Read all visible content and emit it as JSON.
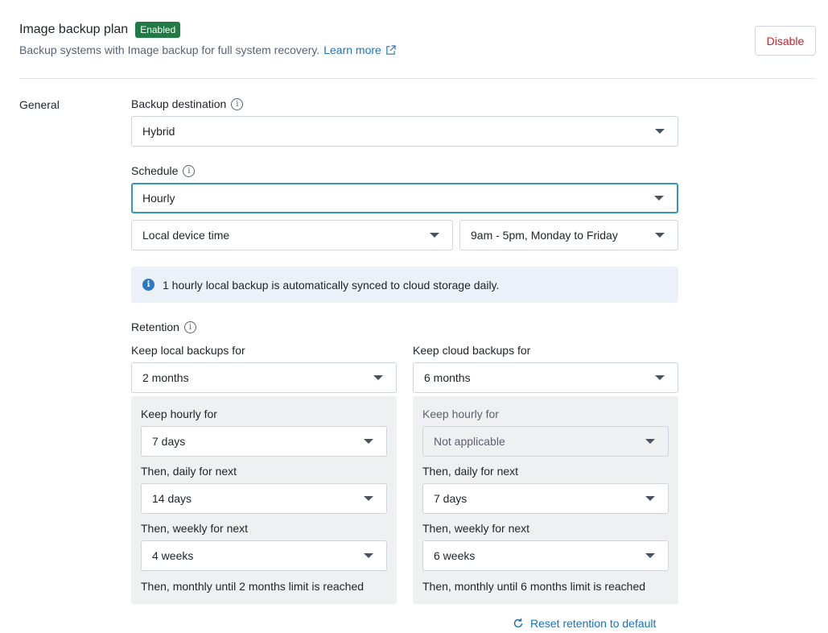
{
  "header": {
    "title": "Image backup plan",
    "badge": "Enabled",
    "subtitle": "Backup systems with Image backup for full system recovery.",
    "learn_more": "Learn more",
    "disable_label": "Disable"
  },
  "general": {
    "section_label": "General",
    "backup_destination": {
      "label": "Backup destination",
      "value": "Hybrid"
    },
    "schedule": {
      "label": "Schedule",
      "frequency": "Hourly",
      "timezone": "Local device time",
      "window": "9am - 5pm, Monday to Friday"
    },
    "info_message": "1 hourly local backup is automatically synced to cloud storage daily.",
    "retention": {
      "label": "Retention",
      "local": {
        "label": "Keep local backups for",
        "value": "2 months",
        "hourly_label": "Keep hourly for",
        "hourly_value": "7 days",
        "daily_label": "Then, daily for next",
        "daily_value": "14 days",
        "weekly_label": "Then, weekly for next",
        "weekly_value": "4 weeks",
        "footer": "Then, monthly until 2 months limit is reached"
      },
      "cloud": {
        "label": "Keep cloud backups for",
        "value": "6 months",
        "hourly_label": "Keep hourly for",
        "hourly_value": "Not applicable",
        "daily_label": "Then, daily for next",
        "daily_value": "7 days",
        "weekly_label": "Then, weekly for next",
        "weekly_value": "6 weeks",
        "footer": "Then, monthly until 6 months limit is reached"
      },
      "reset_label": "Reset retention to default"
    }
  }
}
